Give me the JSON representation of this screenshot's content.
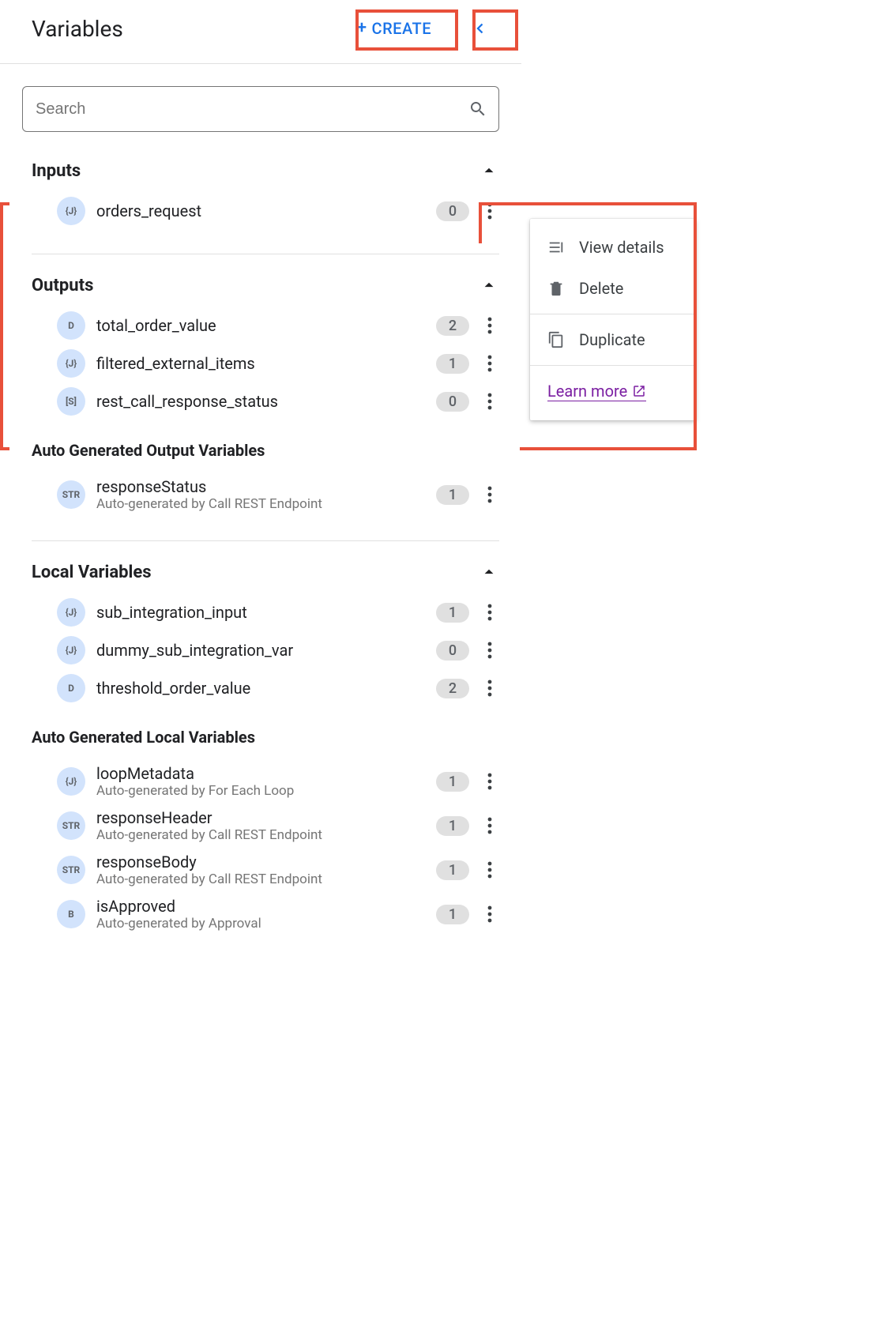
{
  "header": {
    "title": "Variables",
    "create_label": "CREATE"
  },
  "search": {
    "placeholder": "Search"
  },
  "sections": {
    "inputs": {
      "title": "Inputs",
      "items": [
        {
          "type": "{J}",
          "name": "orders_request",
          "count": "0"
        }
      ]
    },
    "outputs": {
      "title": "Outputs",
      "items": [
        {
          "type": "D",
          "name": "total_order_value",
          "count": "2"
        },
        {
          "type": "{J}",
          "name": "filtered_external_items",
          "count": "1"
        },
        {
          "type": "[S]",
          "name": "rest_call_response_status",
          "count": "0"
        }
      ],
      "auto_title": "Auto Generated Output Variables",
      "auto_items": [
        {
          "type": "STR",
          "name": "responseStatus",
          "sub": "Auto-generated by Call REST Endpoint",
          "count": "1"
        }
      ]
    },
    "locals": {
      "title": "Local Variables",
      "items": [
        {
          "type": "{J}",
          "name": "sub_integration_input",
          "count": "1"
        },
        {
          "type": "{J}",
          "name": "dummy_sub_integration_var",
          "count": "0"
        },
        {
          "type": "D",
          "name": "threshold_order_value",
          "count": "2"
        }
      ],
      "auto_title": "Auto Generated Local Variables",
      "auto_items": [
        {
          "type": "{J}",
          "name": "loopMetadata",
          "sub": "Auto-generated by For Each Loop",
          "count": "1"
        },
        {
          "type": "STR",
          "name": "responseHeader",
          "sub": "Auto-generated by Call REST Endpoint",
          "count": "1"
        },
        {
          "type": "STR",
          "name": "responseBody",
          "sub": "Auto-generated by Call REST Endpoint",
          "count": "1"
        },
        {
          "type": "B",
          "name": "isApproved",
          "sub": "Auto-generated by Approval",
          "count": "1"
        }
      ]
    }
  },
  "context_menu": {
    "view_details": "View details",
    "delete": "Delete",
    "duplicate": "Duplicate",
    "learn_more": "Learn more"
  }
}
